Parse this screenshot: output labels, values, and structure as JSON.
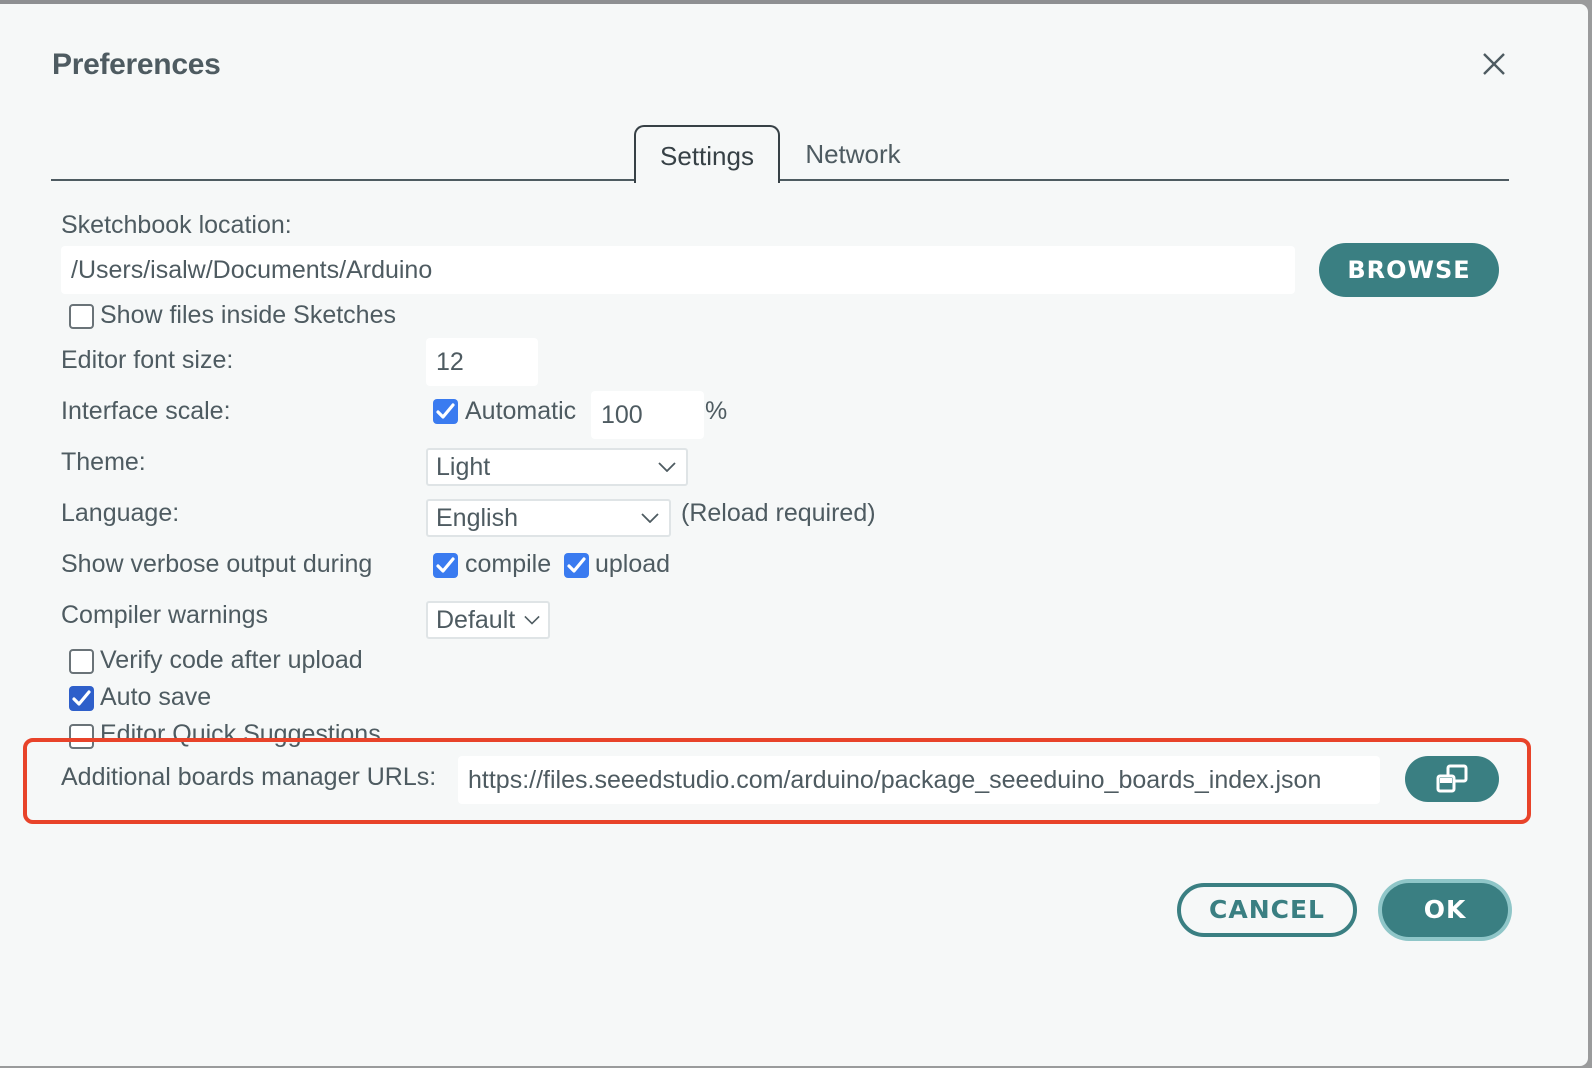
{
  "dialog": {
    "title": "Preferences",
    "close_icon": "close-icon"
  },
  "tabs": [
    {
      "label": "Settings",
      "active": true
    },
    {
      "label": "Network",
      "active": false
    }
  ],
  "settings": {
    "sketchbook_label": "Sketchbook location:",
    "sketchbook_value": "/Users/isalw/Documents/Arduino",
    "browse_label": "BROWSE",
    "show_files_label": "Show files inside Sketches",
    "show_files_checked": false,
    "font_size_label": "Editor font size:",
    "font_size_value": "12",
    "interface_scale_label": "Interface scale:",
    "automatic_label": "Automatic",
    "automatic_checked": true,
    "scale_value": "100",
    "scale_unit": "%",
    "theme_label": "Theme:",
    "theme_value": "Light",
    "language_label": "Language:",
    "language_value": "English",
    "reload_note": "(Reload required)",
    "verbose_label": "Show verbose output during",
    "compile_label": "compile",
    "compile_checked": true,
    "upload_label": "upload",
    "upload_checked": true,
    "compiler_warnings_label": "Compiler warnings",
    "compiler_warnings_value": "Default",
    "verify_label": "Verify code after upload",
    "verify_checked": false,
    "autosave_label": "Auto save",
    "autosave_checked": true,
    "quick_suggestions_label": "Editor Quick Suggestions",
    "quick_suggestions_checked": false,
    "boards_urls_label": "Additional boards manager URLs:",
    "boards_urls_value": "https://files.seeedstudio.com/arduino/package_seeeduino_boards_index.json",
    "boards_urls_button_icon": "open-in-window-icon"
  },
  "footer": {
    "cancel_label": "CANCEL",
    "ok_label": "OK"
  },
  "colors": {
    "accent": "#3a7f82",
    "checkbox": "#3a7bf0",
    "annotation": "#e8432a",
    "text": "#4e5b61"
  }
}
